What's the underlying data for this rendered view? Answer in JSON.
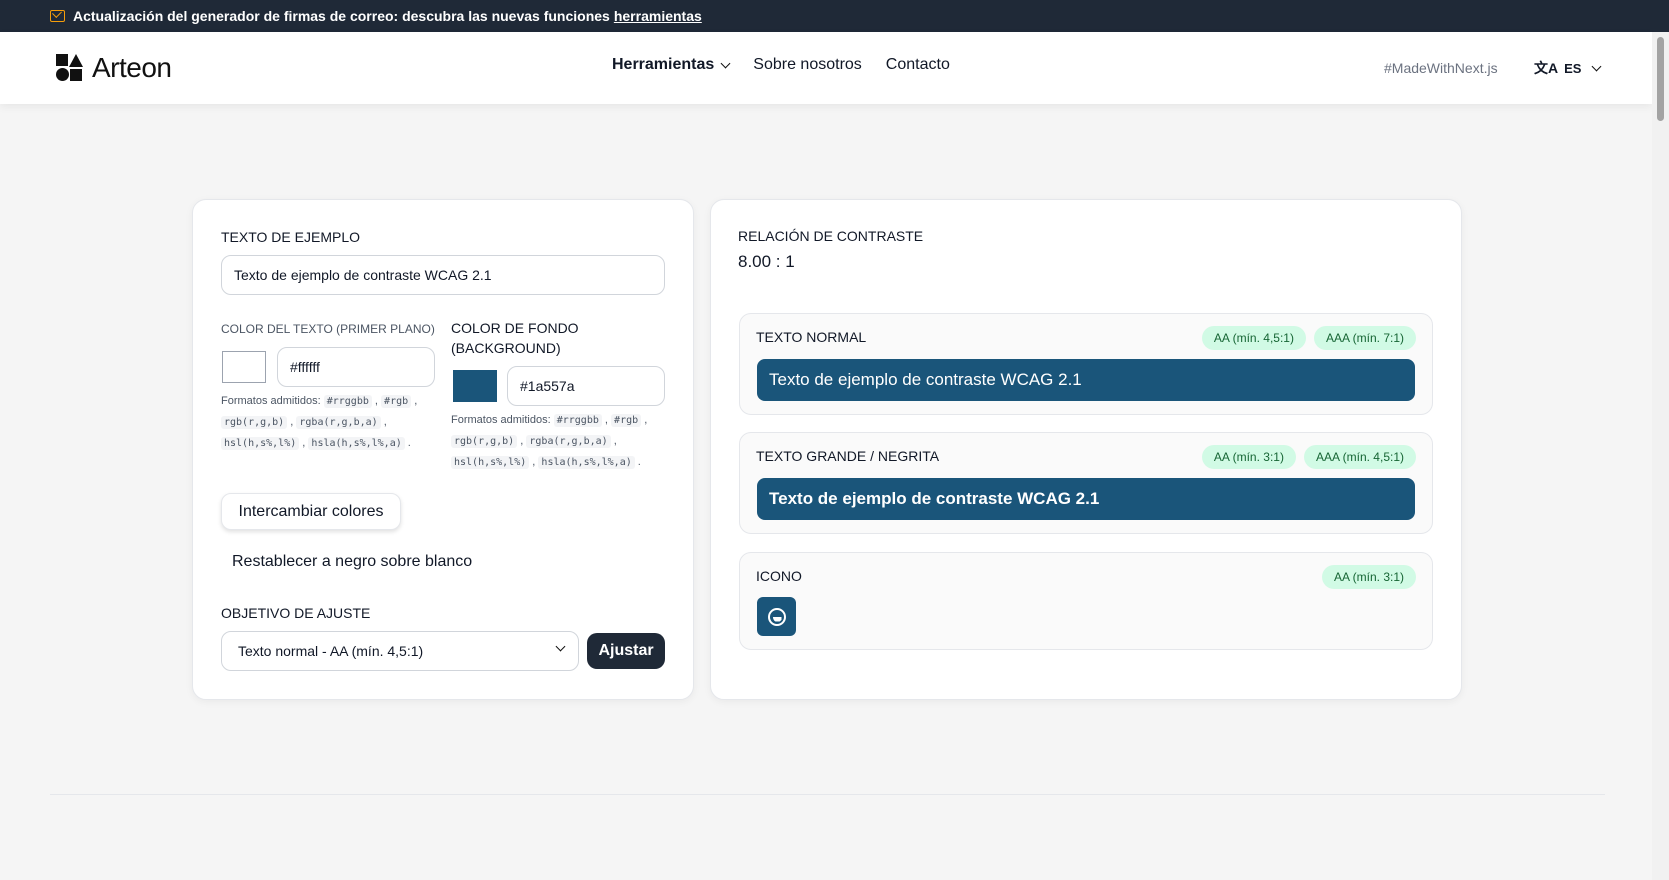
{
  "banner": {
    "text": "Actualización del generador de firmas de correo: descubra las nuevas funciones ",
    "link": "herramientas",
    "icon": "mail-icon"
  },
  "header": {
    "logo": "Arteon",
    "nav": {
      "tools": "Herramientas",
      "about": "Sobre nosotros",
      "contact": "Contacto"
    },
    "made_with": "#MadeWithNext.js",
    "lang": "ES"
  },
  "form": {
    "sample_label": "TEXTO DE EJEMPLO",
    "sample_value": "Texto de ejemplo de contraste WCAG 2.1",
    "fg_label": "COLOR DEL TEXTO (PRIMER PLANO)",
    "fg_value": "#ffffff",
    "bg_label_1": "COLOR DE FONDO",
    "bg_label_2": "(BACKGROUND)",
    "bg_value": "#1a557a",
    "formats_label": "Formatos admitidos:",
    "formats": [
      "#rrggbb",
      "#rgb",
      "rgb(r,g,b)",
      "rgba(r,g,b,a)",
      "hsl(h,s%,l%)",
      "hsla(h,s%,l%,a)"
    ],
    "swap": "Intercambiar colores",
    "reset": "Restablecer a negro sobre blanco",
    "adjust_label": "OBJETIVO DE AJUSTE",
    "adjust_select": "Texto normal - AA (mín. 4,5:1)",
    "adjust_button": "Ajustar"
  },
  "results": {
    "ratio_label": "RELACIÓN DE CONTRASTE",
    "ratio_value": "8.00 : 1",
    "normal": {
      "title": "TEXTO NORMAL",
      "badge_aa": "AA (mín. 4,5:1)",
      "badge_aaa": "AAA (mín. 7:1)",
      "sample": "Texto de ejemplo de contraste WCAG 2.1"
    },
    "large": {
      "title": "TEXTO GRANDE / NEGRITA",
      "badge_aa": "AA (mín. 3:1)",
      "badge_aaa": "AAA (mín. 4,5:1)",
      "sample": "Texto de ejemplo de contraste WCAG 2.1"
    },
    "icon": {
      "title": "ICONO",
      "badge_aa": "AA (mín. 3:1)",
      "icon": "moon-icon"
    }
  },
  "colors": {
    "foreground": "#ffffff",
    "background": "#1a557a",
    "accent_dark": "#1f2937",
    "badge_bg": "#d1fae5",
    "badge_text": "#166534"
  }
}
